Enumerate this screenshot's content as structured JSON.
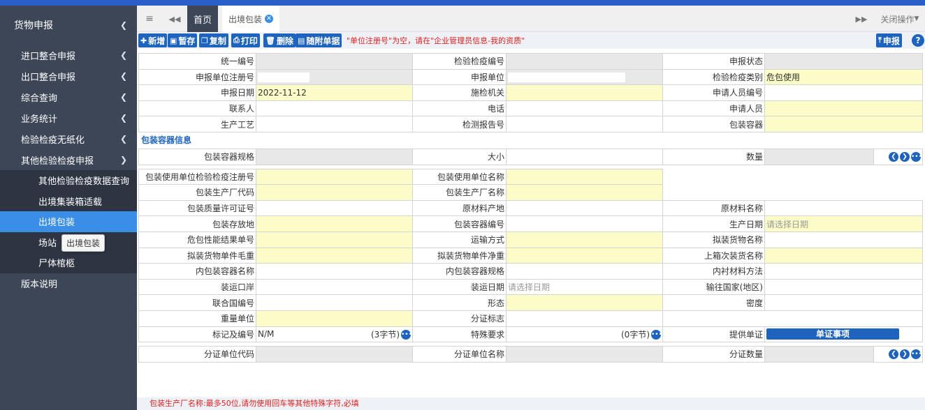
{
  "sidebar": {
    "title": "货物申报",
    "groups": [
      "进口整合申报",
      "出口整合申报",
      "综合查询",
      "业务统计",
      "检验检疫无纸化",
      "其他检验检疫申报"
    ],
    "sub_items": [
      "其他检验检疫数据查询",
      "出境集装箱适载",
      "出境包装",
      "场站",
      "尸体棺柩"
    ],
    "footer_item": "版本说明",
    "tooltip": "出境包装"
  },
  "tabs": {
    "menu_icon": "≡",
    "back_icon": "◀◀",
    "home": "首页",
    "active": "出境包装",
    "forward_icon": "▶▶",
    "close_ops": "关闭操作"
  },
  "toolbar": {
    "new": "新增",
    "save": "暂存",
    "copy": "复制",
    "print": "打印",
    "delete": "删除",
    "attach": "随附单据",
    "warning": "\"单位注册号\"为空，请在\"企业管理员信息-我的资质\"",
    "submit": "申报",
    "help": "?"
  },
  "form": {
    "unified_no": "统一编号",
    "inspection_no": "检验检疫编号",
    "declare_status": "申报状态",
    "declare_unit_reg": "申报单位注册号",
    "declare_unit": "申报单位",
    "inspection_type": "检验检疫类别",
    "inspection_type_value": "危包使用",
    "declare_date": "申报日期",
    "declare_date_value": "2022-11-12",
    "inspection_org": "施检机关",
    "applicant_no": "申请人员编号",
    "contact": "联系人",
    "phone": "电话",
    "applicant": "申请人员",
    "process": "生产工艺",
    "test_report": "检测报告号",
    "container": "包装容器",
    "section_title": "包装容器信息",
    "container_spec": "包装容器规格",
    "size": "大小",
    "quantity": "数量",
    "user_reg_no": "包装使用单位检验检疫注册号",
    "user_name": "包装使用单位名称",
    "maker_code": "包装生产厂代码",
    "maker_name": "包装生产厂名称",
    "quality_license": "包装质量许可证号",
    "material_origin": "原材料产地",
    "material_name": "原材料名称",
    "storage": "包装存放地",
    "container_no": "包装容器编号",
    "prod_date": "生产日期",
    "date_placeholder": "请选择日期",
    "hazard_result": "危包性能结果单号",
    "transport": "运输方式",
    "goods_name": "拟装货物名称",
    "gross_weight": "拟装货物单件毛重",
    "net_weight": "拟装货物单件净重",
    "last_goods": "上箱次装货名称",
    "inner_name": "内包装容器名称",
    "inner_spec": "内包装容器规格",
    "lining": "内衬材料方法",
    "port": "装运口岸",
    "ship_date": "装运日期",
    "dest_country": "输往国家(地区)",
    "un_no": "联合国编号",
    "form_state": "形态",
    "density": "密度",
    "weight_unit": "重量单位",
    "split_flag": "分证标志",
    "mark_no": "标记及编号",
    "mark_value": "N/M",
    "mark_bytes": "(3字节)",
    "special_req": "特殊要求",
    "special_bytes": "(0字节)",
    "docs": "提供单证",
    "docs_btn": "单证事项",
    "split_code": "分证单位代码",
    "split_name": "分证单位名称",
    "split_qty": "分证数量"
  },
  "footer_hint": "包装生产厂名称:最多50位,请勿使用回车等其他特殊字符,必填"
}
